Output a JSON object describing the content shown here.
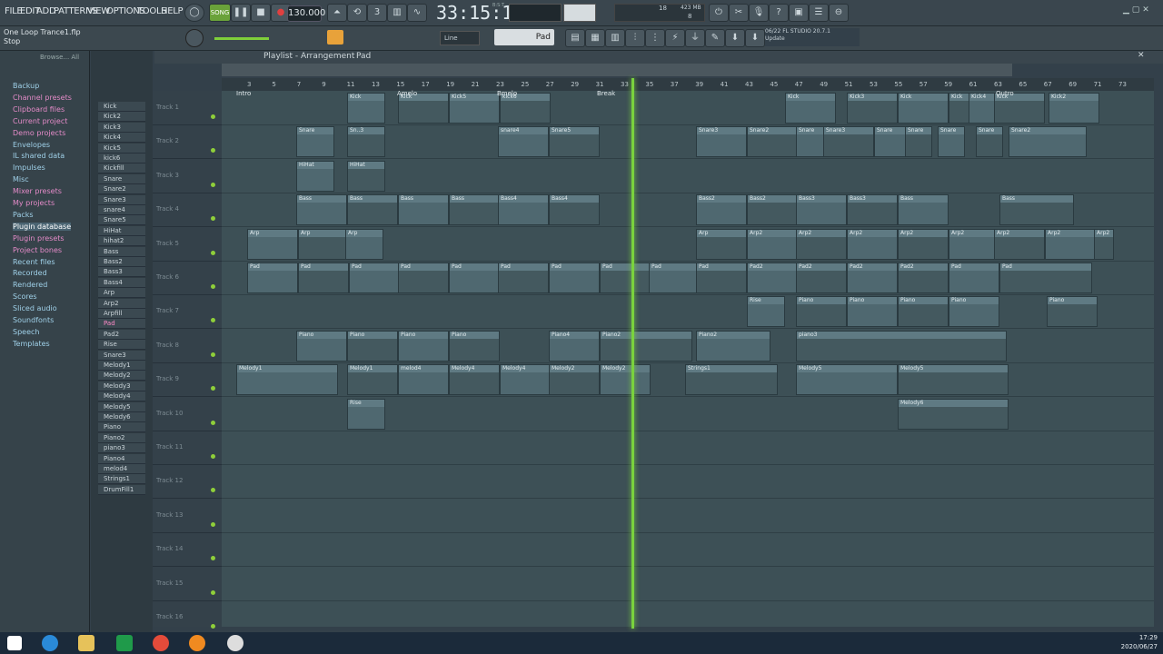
{
  "menu": [
    "FILE",
    "EDIT",
    "ADD",
    "PATTERNS",
    "VIEW",
    "OPTIONS",
    "TOOLS",
    "HELP"
  ],
  "transport": {
    "song_label": "SONG",
    "bpm": "130.000",
    "time": "33:15:11",
    "time_sub": "B:S:T",
    "cpu": "18",
    "mem": "423 MB",
    "voices": "8"
  },
  "project": {
    "file": "One Loop Trance1.flp",
    "status": "Stop"
  },
  "hint": {
    "line_mode": "Line",
    "pattern": "Pad",
    "news_date": "06/22",
    "news_text": "FL STUDIO 20.7.1",
    "news_sub": "Update"
  },
  "browser": {
    "header": "Browse... All",
    "items": [
      "Backup",
      "Channel presets",
      "Clipboard files",
      "Current project",
      "Demo projects",
      "Envelopes",
      "IL shared data",
      "Impulses",
      "Misc",
      "Mixer presets",
      "My projects",
      "Packs",
      "Plugin database",
      "Plugin presets",
      "Project bones",
      "Recent files",
      "Recorded",
      "Rendered",
      "Scores",
      "Sliced audio",
      "Soundfonts",
      "Speech",
      "Templates"
    ]
  },
  "channels": [
    "Kick",
    "Kick2",
    "Kick3",
    "Kick4",
    "Kick5",
    "kick6",
    "Kickfill",
    "Snare",
    "Snare2",
    "Snare3",
    "snare4",
    "Snare5",
    "HiHat",
    "hihat2",
    "Bass",
    "Bass2",
    "Bass3",
    "Bass4",
    "Arp",
    "Arp2",
    "Arpfill",
    "Pad",
    "Pad2",
    "Rise",
    "Snare3",
    "Melody1",
    "Melody2",
    "Melody3",
    "Melody4",
    "Melody5",
    "Melody6",
    "Piano",
    "Piano2",
    "piano3",
    "Piano4",
    "melod4",
    "Strings1",
    "DrumFill1"
  ],
  "playlist": {
    "title": "Playlist - Arrangement",
    "pattern": "Pad"
  },
  "markers": [
    "Intro",
    "Amelo",
    "Bmelo",
    "Break",
    "Outro"
  ],
  "ruler": [
    "3",
    "5",
    "7",
    "9",
    "11",
    "13",
    "15",
    "17",
    "19",
    "21",
    "23",
    "25",
    "27",
    "29",
    "31",
    "33",
    "35",
    "37",
    "39",
    "41",
    "43",
    "45",
    "47",
    "49",
    "51",
    "53",
    "55",
    "57",
    "59",
    "61",
    "63",
    "65",
    "67",
    "69",
    "71",
    "73"
  ],
  "tracks": [
    "Track 1",
    "Track 2",
    "Track 3",
    "Track 4",
    "Track 5",
    "Track 6",
    "Track 7",
    "Track 8",
    "Track 9",
    "Track 10",
    "Track 11",
    "Track 12",
    "Track 13",
    "Track 14",
    "Track 15",
    "Track 16"
  ],
  "clip_labels": {
    "t1": [
      "Kick",
      "Kick",
      "Kick5",
      "kick6",
      "Kick",
      "Kick3",
      "Kick",
      "Kick",
      "Kick4",
      "Kick",
      "Kick2"
    ],
    "t2": [
      "Snare",
      "Sn..3",
      "snare4",
      "Snare5",
      "Snare3",
      "Snare2",
      "Snare",
      "Snare3",
      "Snare",
      "Snare",
      "Snare",
      "Snare",
      "Snare2"
    ],
    "t3": [
      "HiHat",
      "HiHat"
    ],
    "t4": [
      "Bass",
      "Bass",
      "Bass",
      "Bass",
      "Bass4",
      "Bass4",
      "Bass2",
      "Bass2",
      "Bass3",
      "Bass3",
      "Bass",
      "Bass"
    ],
    "t5": [
      "Arp",
      "Arp",
      "Arp",
      "Arp",
      "Arp2",
      "Arp2",
      "Arp2",
      "Arp2",
      "Arp2",
      "Arp2",
      "Arp2",
      "Arp2"
    ],
    "t6": [
      "Pad",
      "Pad",
      "Pad",
      "Pad",
      "Pad",
      "Pad",
      "Pad",
      "Pad",
      "Pad",
      "Pad",
      "Pad2",
      "Pad2",
      "Pad2",
      "Pad2",
      "Pad",
      "Pad"
    ],
    "t7": [
      "Rise",
      "Piano",
      "Piano",
      "Piano",
      "Piano",
      "Piano"
    ],
    "t8": [
      "Piano",
      "Piano",
      "Piano",
      "Piano",
      "Piano4",
      "Piano2",
      "Piano2",
      "piano3"
    ],
    "t9": [
      "Melody1",
      "Melody1",
      "melod4",
      "Melody4",
      "Melody4",
      "Melody2",
      "Melody2",
      "Strings1",
      "Melody5",
      "Melody5"
    ],
    "t10": [
      "Rise",
      "Melody6"
    ]
  },
  "taskbar": {
    "time": "17:29",
    "date": "2020/06/27"
  }
}
